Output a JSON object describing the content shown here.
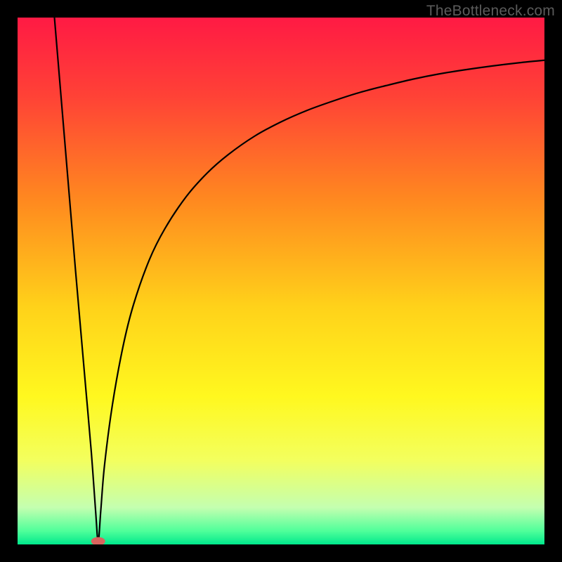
{
  "watermark": "TheBottleneck.com",
  "chart_data": {
    "type": "line",
    "title": "",
    "xlabel": "",
    "ylabel": "",
    "xlim": [
      0,
      100
    ],
    "ylim": [
      0,
      100
    ],
    "background_gradient": {
      "stops": [
        {
          "offset": 0.0,
          "color": "#ff1a44"
        },
        {
          "offset": 0.15,
          "color": "#ff4236"
        },
        {
          "offset": 0.35,
          "color": "#ff8a1f"
        },
        {
          "offset": 0.55,
          "color": "#ffd21a"
        },
        {
          "offset": 0.72,
          "color": "#fff81f"
        },
        {
          "offset": 0.84,
          "color": "#f3ff5e"
        },
        {
          "offset": 0.93,
          "color": "#c4ffb0"
        },
        {
          "offset": 0.975,
          "color": "#4eff9a"
        },
        {
          "offset": 1.0,
          "color": "#00e88c"
        }
      ]
    },
    "marker": {
      "x": 15.3,
      "y": 0.6,
      "color": "#d9645e"
    },
    "series": [
      {
        "name": "curve",
        "x": [
          7.0,
          8.0,
          9.0,
          10.0,
          11.0,
          12.0,
          13.0,
          14.0,
          14.8,
          15.3,
          15.8,
          16.5,
          18.0,
          20.0,
          22.0,
          25.0,
          28.0,
          32.0,
          36.0,
          40.0,
          45.0,
          50.0,
          55.0,
          60.0,
          65.0,
          70.0,
          75.0,
          80.0,
          85.0,
          90.0,
          95.0,
          100.0
        ],
        "values": [
          100,
          88.0,
          76.0,
          64.0,
          52.0,
          40.5,
          29.0,
          17.5,
          6.5,
          0.6,
          6.5,
          15.0,
          26.5,
          37.5,
          45.5,
          54.0,
          60.0,
          66.0,
          70.5,
          74.0,
          77.5,
          80.2,
          82.4,
          84.2,
          85.8,
          87.1,
          88.3,
          89.3,
          90.1,
          90.8,
          91.4,
          91.9
        ]
      }
    ]
  }
}
